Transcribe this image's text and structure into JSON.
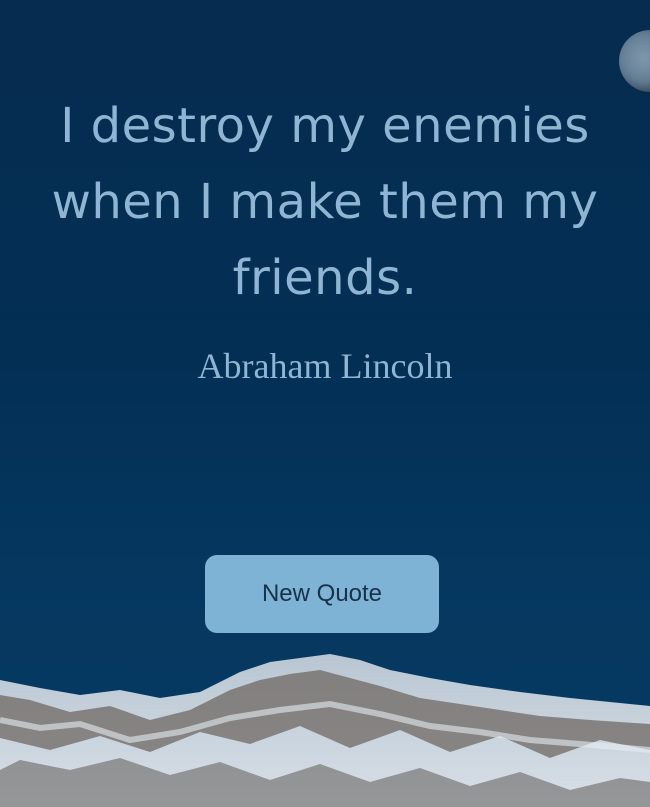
{
  "quote": {
    "text": "I destroy my enemies when I make them my friends.",
    "author": "Abraham Lincoln"
  },
  "controls": {
    "new_quote_label": "New Quote"
  },
  "background": {
    "sky_color": "#032f55",
    "text_color": "#8fb5d3",
    "button_color": "#7fb3d5"
  }
}
